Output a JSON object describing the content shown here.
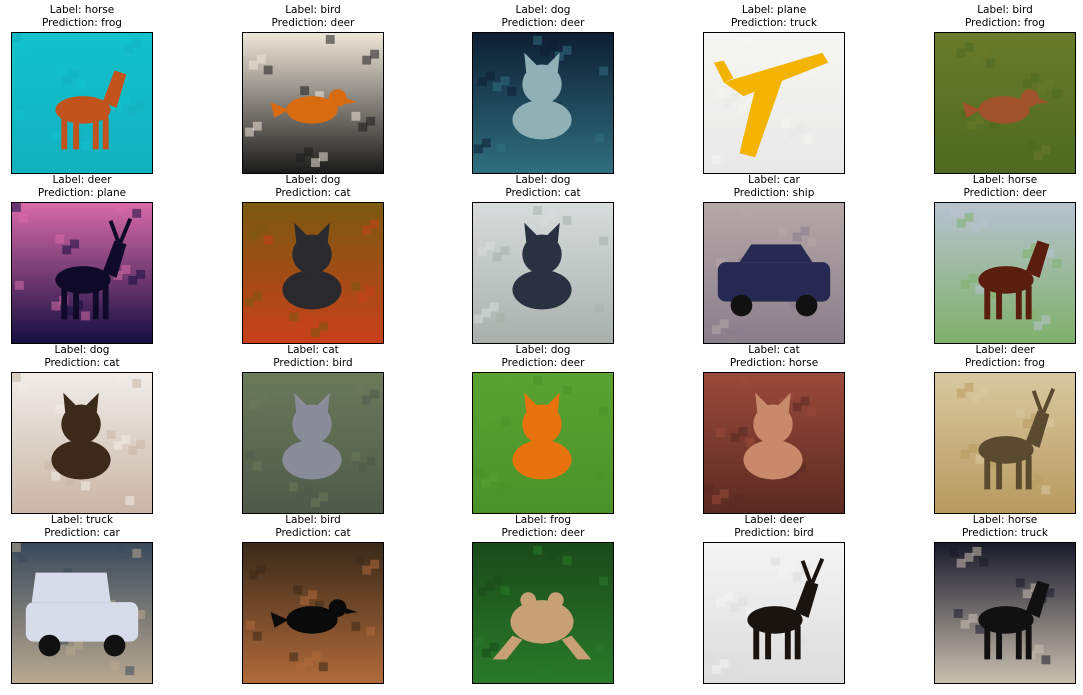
{
  "panels": [
    {
      "label": "Label: horse",
      "prediction": "Prediction: frog",
      "subject": "horse",
      "colors": {
        "top": "#13c2cc",
        "bottom": "#12b1be",
        "subject": "#c2531c"
      }
    },
    {
      "label": "Label: bird",
      "prediction": "Prediction: deer",
      "subject": "bird",
      "colors": {
        "top": "#eee6d8",
        "bottom": "#1b1b1b",
        "subject": "#d86a10"
      }
    },
    {
      "label": "Label: dog",
      "prediction": "Prediction: deer",
      "subject": "dog",
      "colors": {
        "top": "#0e1e32",
        "bottom": "#2f6f7f",
        "subject": "#8fb1b6"
      }
    },
    {
      "label": "Label: plane",
      "prediction": "Prediction: truck",
      "subject": "plane",
      "colors": {
        "top": "#f6f6f4",
        "bottom": "#e8e8e8",
        "subject": "#f2b400"
      }
    },
    {
      "label": "Label: bird",
      "prediction": "Prediction: frog",
      "subject": "bird",
      "colors": {
        "top": "#6a7a2a",
        "bottom": "#4d6a20",
        "subject": "#a0522d"
      }
    },
    {
      "label": "Label: deer",
      "prediction": "Prediction: plane",
      "subject": "deer",
      "colors": {
        "top": "#d86aa8",
        "bottom": "#150f40",
        "subject": "#0f0a2a"
      }
    },
    {
      "label": "Label: dog",
      "prediction": "Prediction: cat",
      "subject": "cat",
      "colors": {
        "top": "#7a5a10",
        "bottom": "#c8401a",
        "subject": "#2a2a2e"
      }
    },
    {
      "label": "Label: dog",
      "prediction": "Prediction: cat",
      "subject": "dog",
      "colors": {
        "top": "#d8dcdc",
        "bottom": "#a8b0ac",
        "subject": "#2a3140"
      }
    },
    {
      "label": "Label: car",
      "prediction": "Prediction: ship",
      "subject": "car",
      "colors": {
        "top": "#b7a7a8",
        "bottom": "#8a7e8a",
        "subject": "#262a52"
      }
    },
    {
      "label": "Label: horse",
      "prediction": "Prediction: deer",
      "subject": "horse",
      "colors": {
        "top": "#b8c2d0",
        "bottom": "#7fb06a",
        "subject": "#5a1e0e"
      }
    },
    {
      "label": "Label: dog",
      "prediction": "Prediction: cat",
      "subject": "dog",
      "colors": {
        "top": "#f0ece8",
        "bottom": "#c9b6a6",
        "subject": "#3b2a1a"
      }
    },
    {
      "label": "Label: cat",
      "prediction": "Prediction: bird",
      "subject": "cat",
      "colors": {
        "top": "#6a7a5a",
        "bottom": "#4e5a4a",
        "subject": "#8a8c9a"
      }
    },
    {
      "label": "Label: dog",
      "prediction": "Prediction: deer",
      "subject": "dog",
      "colors": {
        "top": "#5aa232",
        "bottom": "#4a9228",
        "subject": "#e8720e"
      }
    },
    {
      "label": "Label: cat",
      "prediction": "Prediction: horse",
      "subject": "cat",
      "colors": {
        "top": "#9a4a3a",
        "bottom": "#5a2a22",
        "subject": "#c88a6a"
      }
    },
    {
      "label": "Label: deer",
      "prediction": "Prediction: frog",
      "subject": "deer",
      "colors": {
        "top": "#d8c8a0",
        "bottom": "#b89a60",
        "subject": "#5a4a30"
      }
    },
    {
      "label": "Label: truck",
      "prediction": "Prediction: car",
      "subject": "truck",
      "colors": {
        "top": "#3a4a5a",
        "bottom": "#b8a890",
        "subject": "#d8dcea"
      }
    },
    {
      "label": "Label: bird",
      "prediction": "Prediction: cat",
      "subject": "bird",
      "colors": {
        "top": "#3a2a1a",
        "bottom": "#b06a3a",
        "subject": "#0a0a0a"
      }
    },
    {
      "label": "Label: frog",
      "prediction": "Prediction: deer",
      "subject": "frog",
      "colors": {
        "top": "#1a4a1a",
        "bottom": "#2a7a2a",
        "subject": "#c8a078"
      }
    },
    {
      "label": "Label: deer",
      "prediction": "Prediction: bird",
      "subject": "deer",
      "colors": {
        "top": "#f4f4f4",
        "bottom": "#dcdcdc",
        "subject": "#1a1410"
      }
    },
    {
      "label": "Label: horse",
      "prediction": "Prediction: truck",
      "subject": "horse",
      "colors": {
        "top": "#1a1a2a",
        "bottom": "#c8c0b0",
        "subject": "#111111"
      }
    }
  ]
}
